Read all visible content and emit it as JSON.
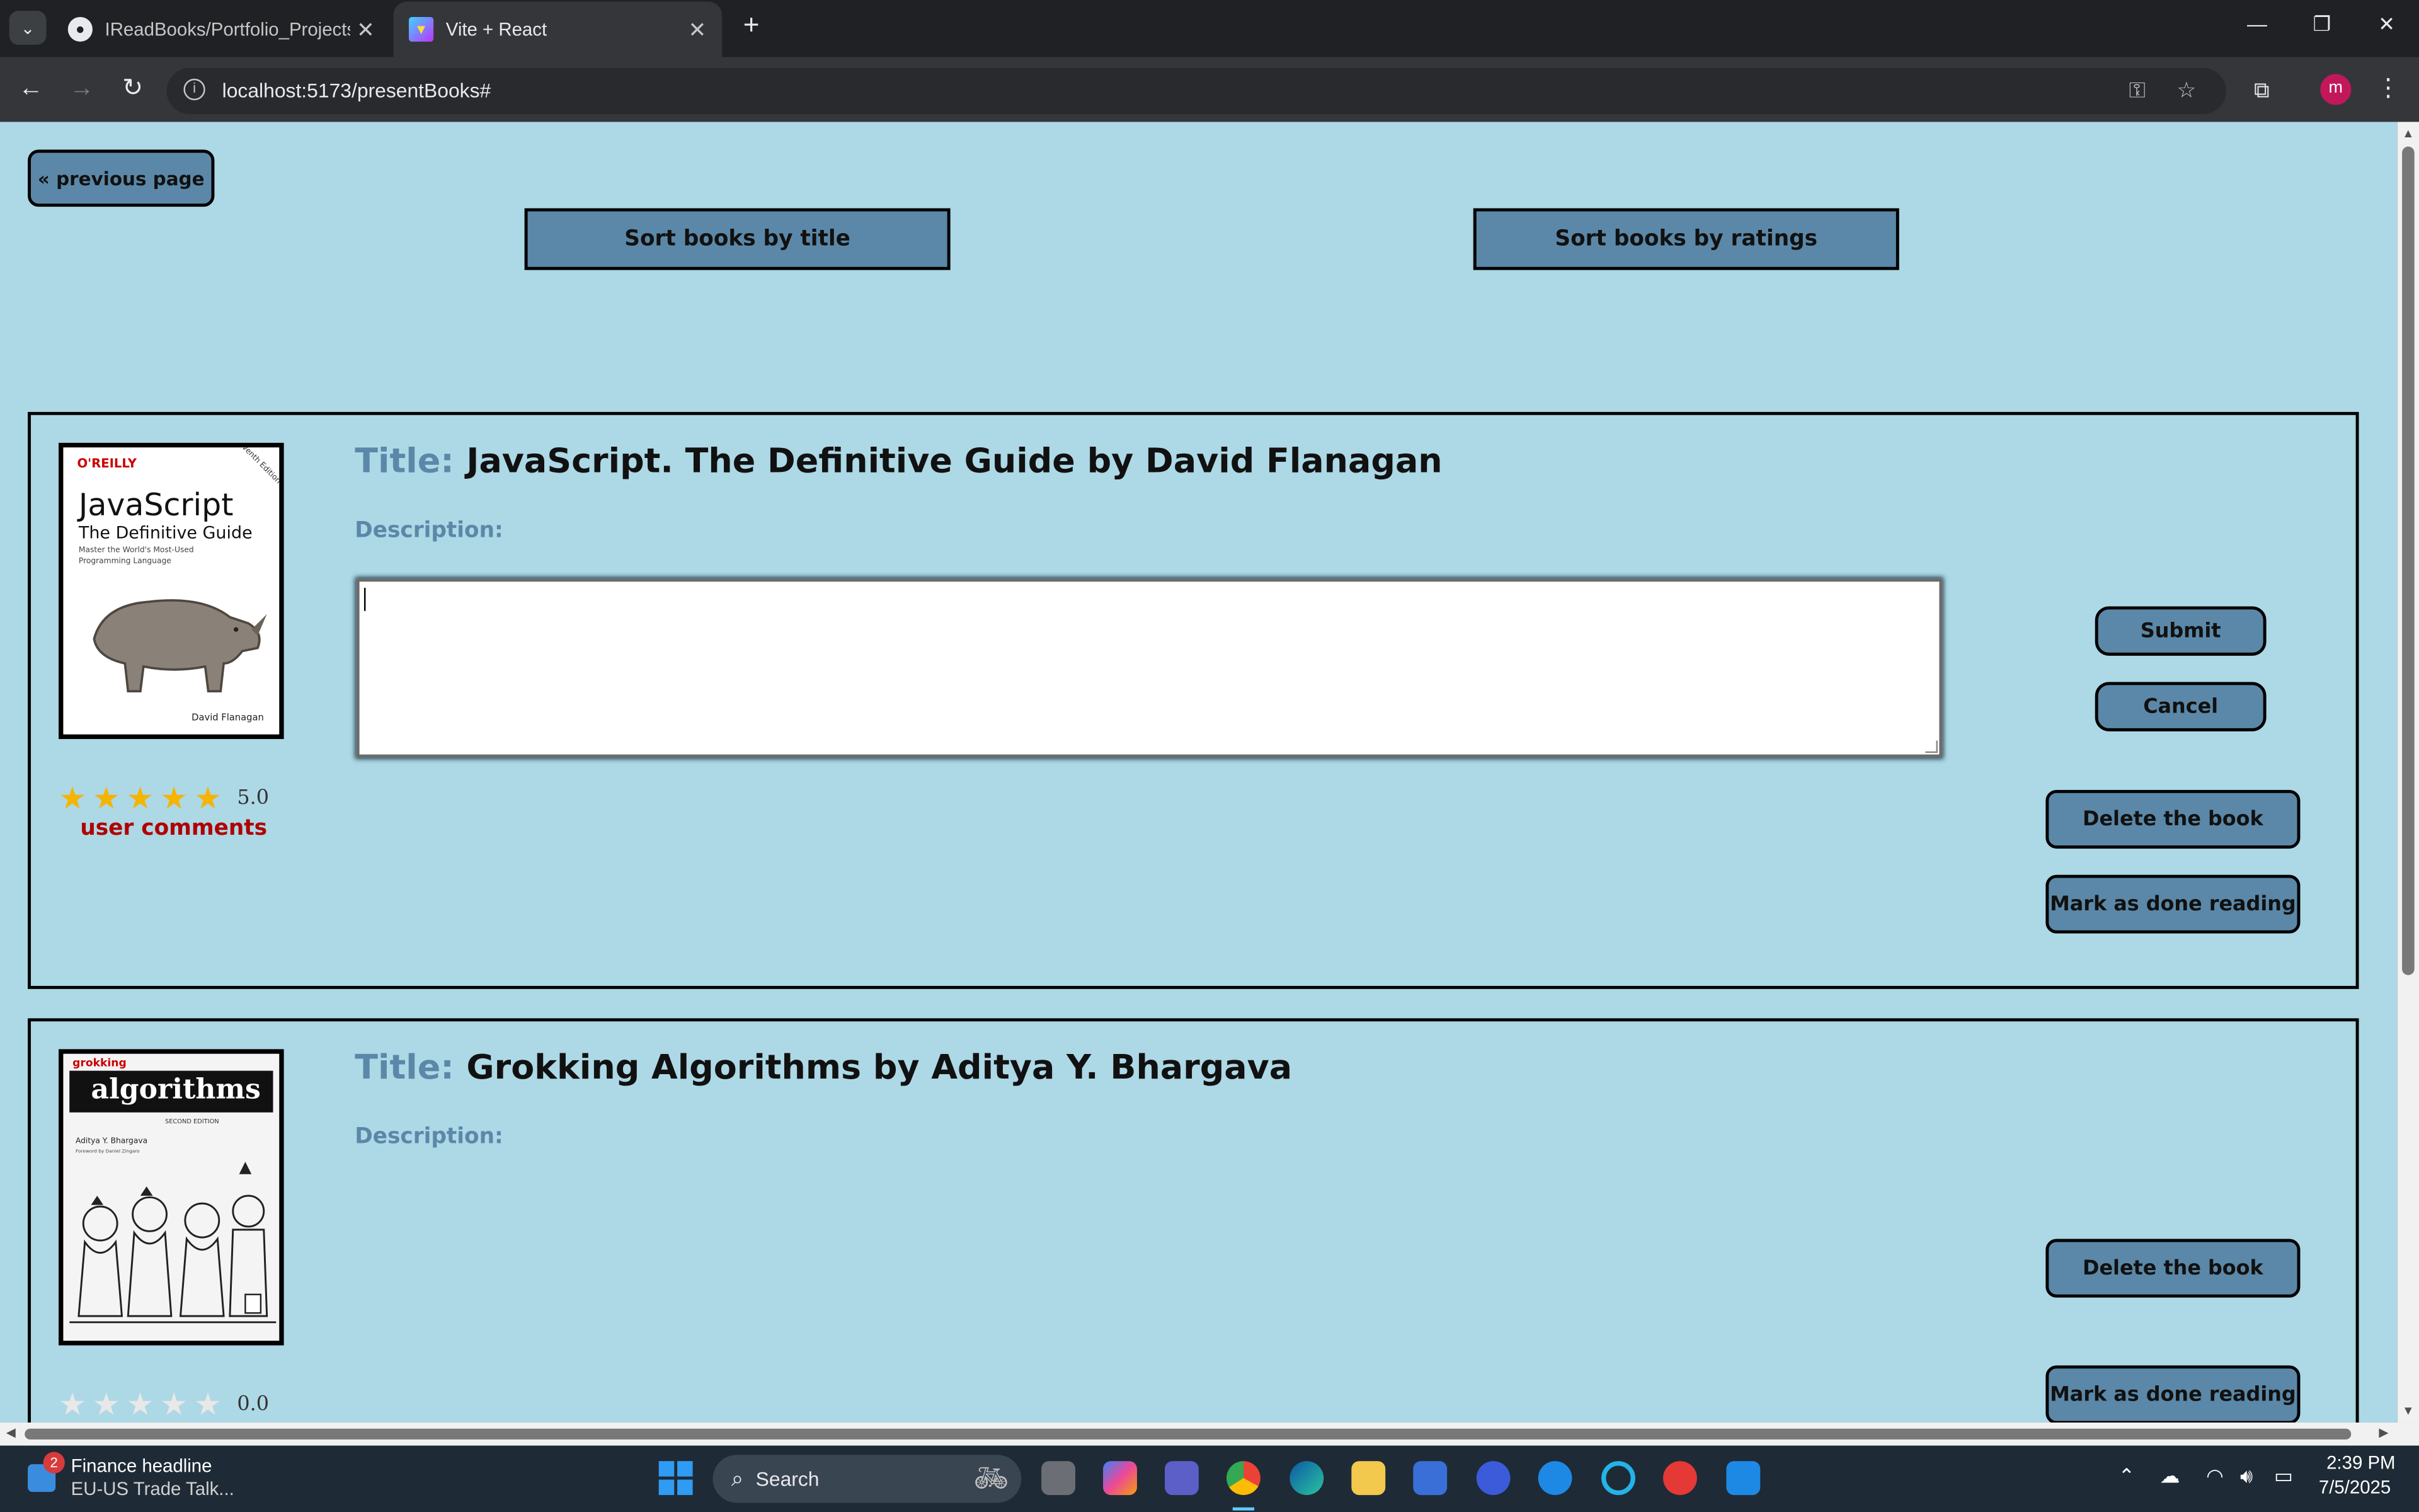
{
  "browser": {
    "tabs": [
      {
        "title": "IReadBooks/Portfolio_Projects/I",
        "favicon": "github-icon",
        "active": false
      },
      {
        "title": "Vite + React",
        "favicon": "vite-icon",
        "active": true
      }
    ],
    "url": "localhost:5173/presentBooks#",
    "profile_initial": "m"
  },
  "page": {
    "previous_label": "« previous page",
    "sort_title_label": "Sort books by title",
    "sort_ratings_label": "Sort books by ratings",
    "books": [
      {
        "title_label": "Title:",
        "title": "JavaScript. The Definitive Guide by David Flanagan",
        "description_label": "Description:",
        "rating": 5,
        "rating_text": "5.0",
        "comments_label": "user comments",
        "submit_label": "Submit",
        "cancel_label": "Cancel",
        "delete_label": "Delete the book",
        "done_label": "Mark as done reading",
        "cover": {
          "publisher": "O'REILLY",
          "badge": "Seventh Edition",
          "title": "JavaScript",
          "subtitle": "The Definitive Guide",
          "tagline": "Master the World's Most-Used Programming Language",
          "author": "David Flanagan"
        }
      },
      {
        "title_label": "Title:",
        "title": "Grokking Algorithms by Aditya Y. Bhargava",
        "description_label": "Description:",
        "rating": 0,
        "rating_text": "0.0",
        "delete_label": "Delete the book",
        "done_label": "Mark as done reading",
        "cover": {
          "series": "grokking",
          "title": "algorithms",
          "edition": "SECOND EDITION",
          "author": "Aditya Y. Bhargava",
          "foreword": "Foreword by Daniel Zingaro"
        }
      }
    ]
  },
  "taskbar": {
    "news_badge": "2",
    "news_title": "Finance headline",
    "news_text": "EU-US Trade Talk...",
    "search_label": "Search",
    "time": "2:39 PM",
    "date": "7/5/2025"
  },
  "colors": {
    "page_bg": "#add8e6",
    "button": "#5b88a8",
    "label": "#5b88a8",
    "comments": "#b00000",
    "star_on": "#f5b400",
    "star_off": "#e8e8e8"
  }
}
